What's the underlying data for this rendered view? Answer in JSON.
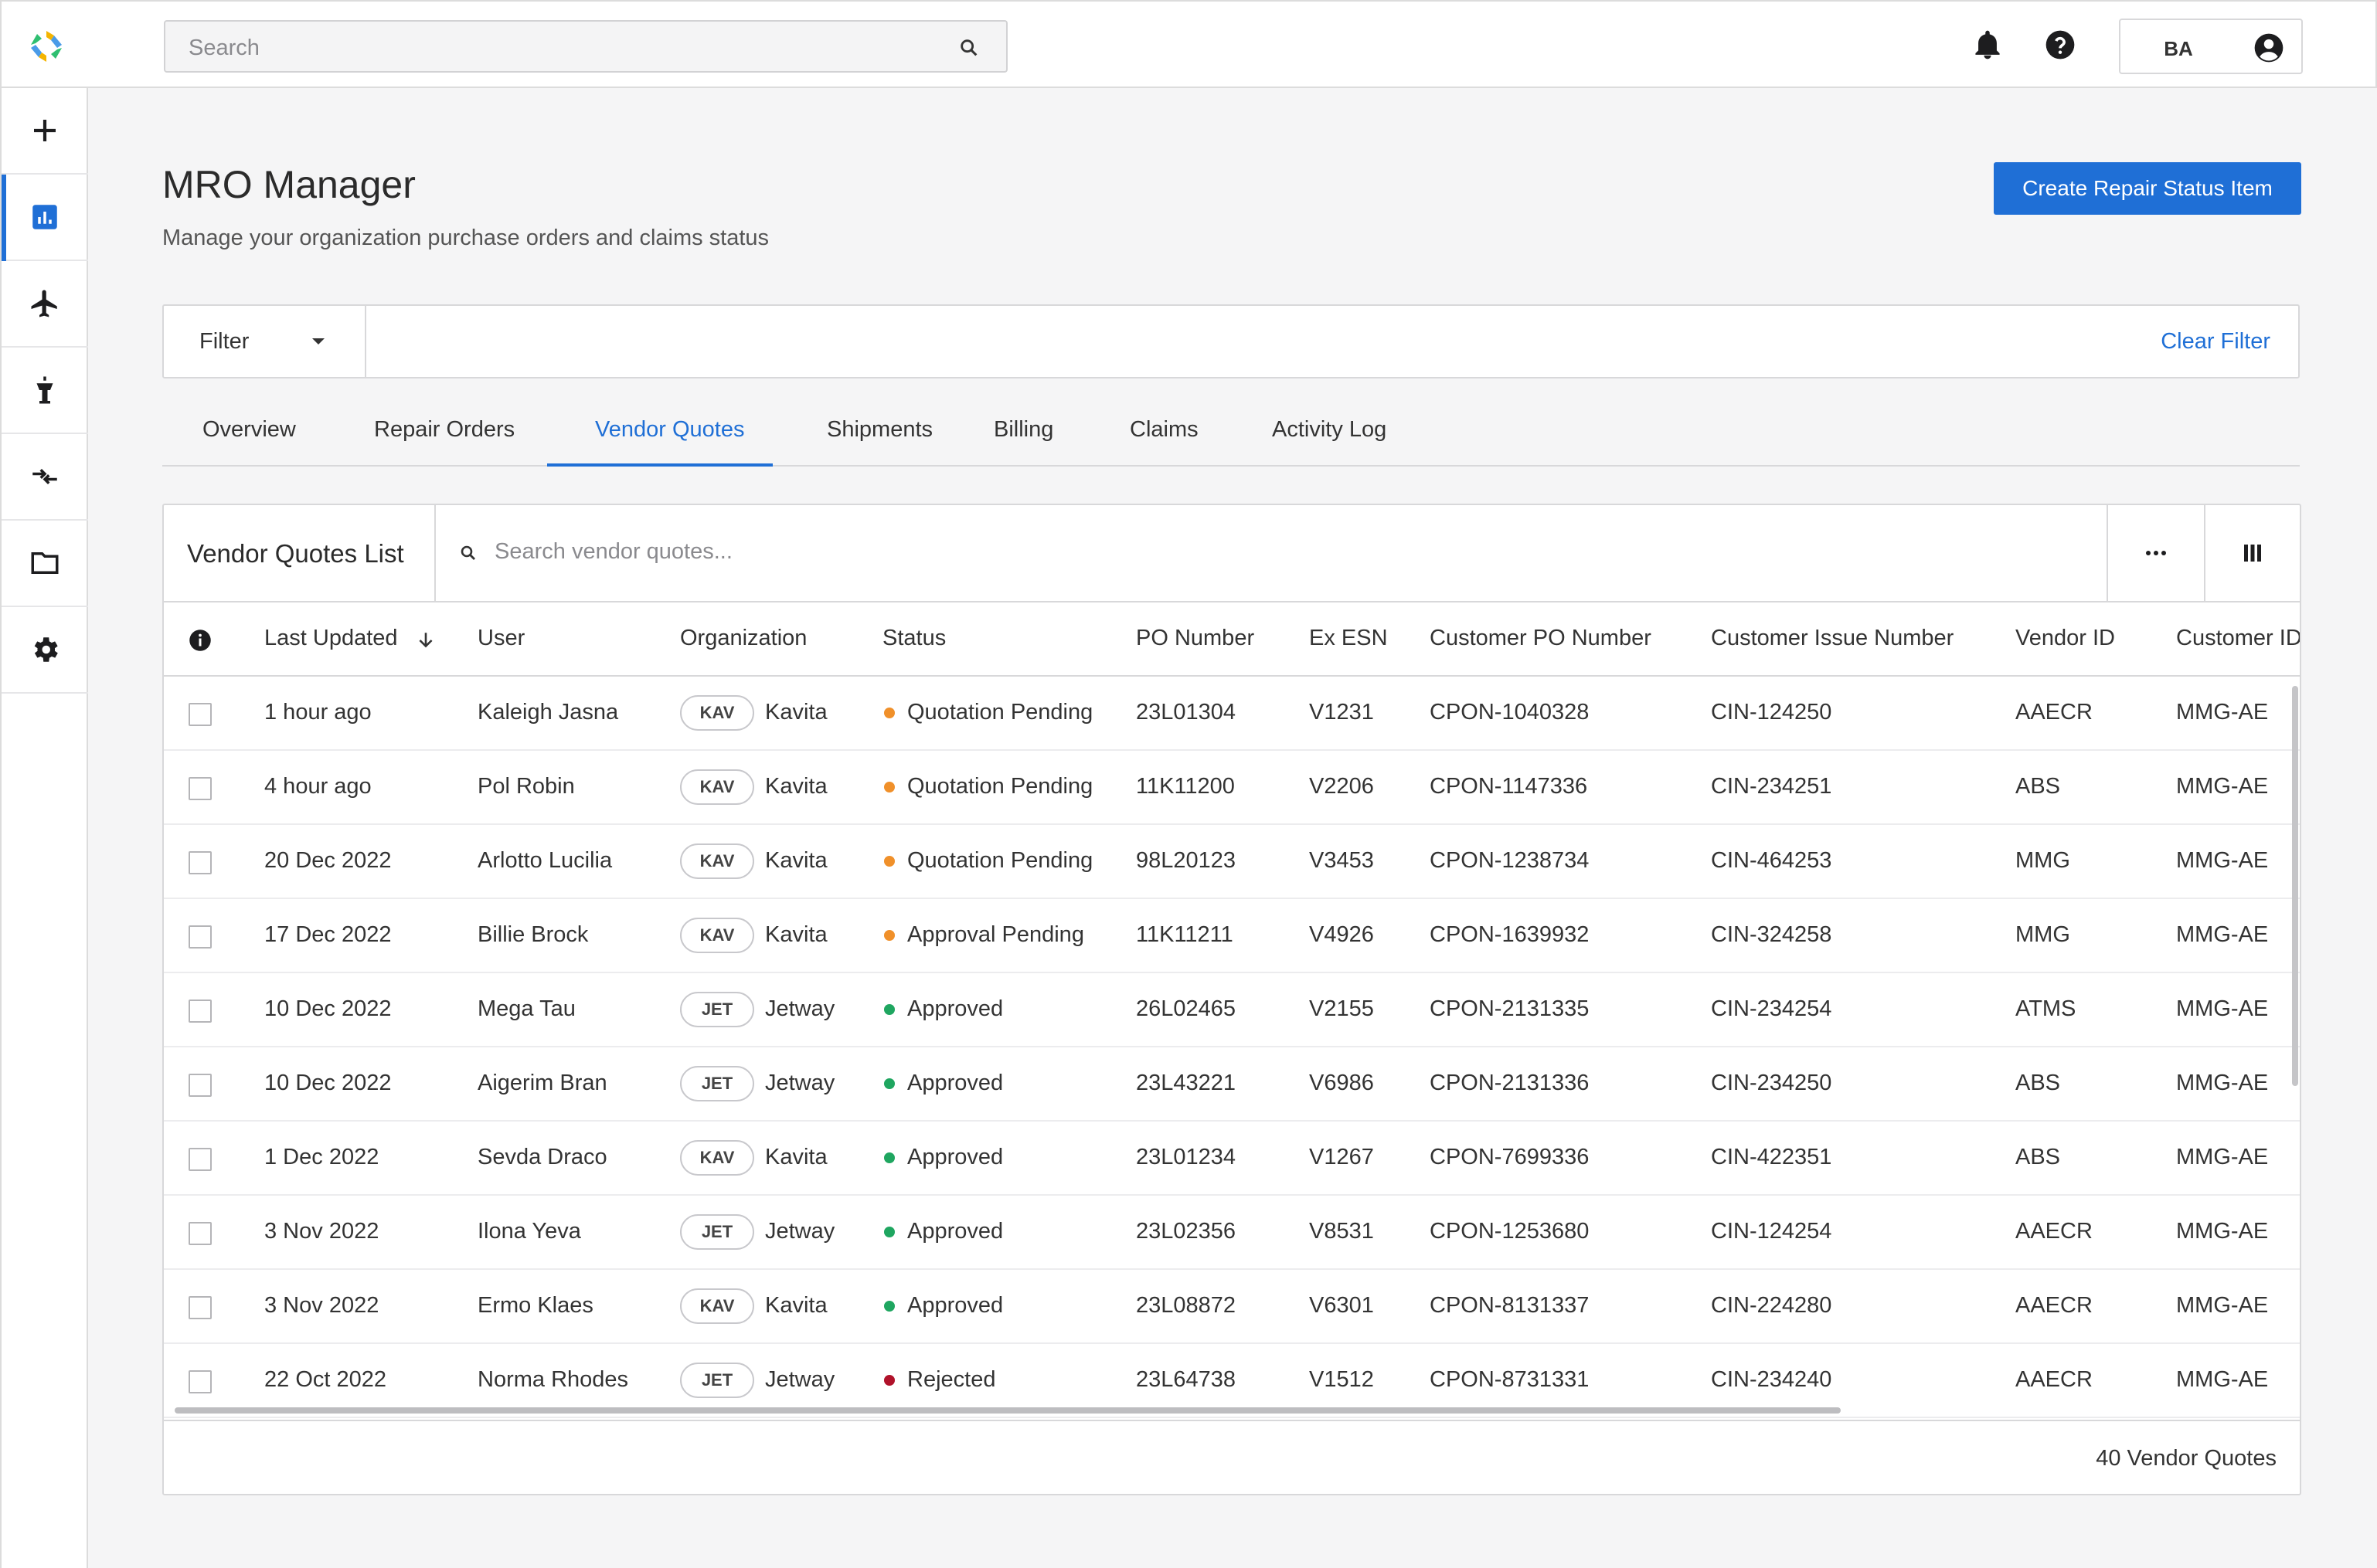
{
  "header": {
    "search_placeholder": "Search",
    "user_initials": "BA"
  },
  "sidebar": {
    "items": [
      {
        "icon": "plus-icon"
      },
      {
        "icon": "dashboard-icon",
        "active": true
      },
      {
        "icon": "airplane-icon"
      },
      {
        "icon": "control-tower-icon"
      },
      {
        "icon": "transfer-arrows-icon"
      },
      {
        "icon": "folder-icon"
      },
      {
        "icon": "gear-icon"
      }
    ]
  },
  "page": {
    "title": "MRO Manager",
    "subtitle": "Manage your organization purchase orders and claims status",
    "create_button": "Create Repair Status Item"
  },
  "filter": {
    "label": "Filter",
    "clear": "Clear Filter"
  },
  "tabs": [
    "Overview",
    "Repair Orders",
    "Vendor Quotes",
    "Shipments",
    "Billing",
    "Claims",
    "Activity Log"
  ],
  "active_tab": "Vendor Quotes",
  "panel": {
    "title": "Vendor Quotes List",
    "search_placeholder": "Search vendor quotes...",
    "count_label": "40 Vendor Quotes"
  },
  "table": {
    "columns": [
      "Last Updated",
      "User",
      "Organization",
      "Status",
      "PO Number",
      "Ex ESN",
      "Customer PO Number",
      "Customer Issue Number",
      "Vendor ID",
      "Customer ID"
    ],
    "status_colors": {
      "Quotation Pending": "#f0902a",
      "Approval Pending": "#f0902a",
      "Approved": "#1fa660",
      "Rejected": "#b0122a"
    },
    "rows": [
      {
        "updated": "1 hour ago",
        "user": "Kaleigh Jasna",
        "org_code": "KAV",
        "org": "Kavita",
        "status": "Quotation Pending",
        "po": "23L01304",
        "esn": "V1231",
        "cpo": "CPON-1040328",
        "cin": "CIN-124250",
        "vendor": "AAECR",
        "customer": "MMG-AE"
      },
      {
        "updated": "4 hour ago",
        "user": "Pol Robin",
        "org_code": "KAV",
        "org": "Kavita",
        "status": "Quotation Pending",
        "po": "11K11200",
        "esn": "V2206",
        "cpo": "CPON-1147336",
        "cin": "CIN-234251",
        "vendor": "ABS",
        "customer": "MMG-AE"
      },
      {
        "updated": "20 Dec 2022",
        "user": "Arlotto Lucilia",
        "org_code": "KAV",
        "org": "Kavita",
        "status": "Quotation Pending",
        "po": "98L20123",
        "esn": "V3453",
        "cpo": "CPON-1238734",
        "cin": "CIN-464253",
        "vendor": "MMG",
        "customer": "MMG-AE"
      },
      {
        "updated": "17 Dec 2022",
        "user": "Billie Brock",
        "org_code": "KAV",
        "org": "Kavita",
        "status": "Approval Pending",
        "po": "11K11211",
        "esn": "V4926",
        "cpo": "CPON-1639932",
        "cin": "CIN-324258",
        "vendor": "MMG",
        "customer": "MMG-AE"
      },
      {
        "updated": "10 Dec 2022",
        "user": "Mega Tau",
        "org_code": "JET",
        "org": "Jetway",
        "status": "Approved",
        "po": "26L02465",
        "esn": "V2155",
        "cpo": "CPON-2131335",
        "cin": "CIN-234254",
        "vendor": "ATMS",
        "customer": "MMG-AE"
      },
      {
        "updated": "10 Dec 2022",
        "user": "Aigerim Bran",
        "org_code": "JET",
        "org": "Jetway",
        "status": "Approved",
        "po": "23L43221",
        "esn": "V6986",
        "cpo": "CPON-2131336",
        "cin": "CIN-234250",
        "vendor": "ABS",
        "customer": "MMG-AE"
      },
      {
        "updated": "1 Dec 2022",
        "user": "Sevda Draco",
        "org_code": "KAV",
        "org": "Kavita",
        "status": "Approved",
        "po": "23L01234",
        "esn": "V1267",
        "cpo": "CPON-7699336",
        "cin": "CIN-422351",
        "vendor": "ABS",
        "customer": "MMG-AE"
      },
      {
        "updated": "3 Nov 2022",
        "user": "Ilona Yeva",
        "org_code": "JET",
        "org": "Jetway",
        "status": "Approved",
        "po": "23L02356",
        "esn": "V8531",
        "cpo": "CPON-1253680",
        "cin": "CIN-124254",
        "vendor": "AAECR",
        "customer": "MMG-AE"
      },
      {
        "updated": "3 Nov 2022",
        "user": "Ermo Klaes",
        "org_code": "KAV",
        "org": "Kavita",
        "status": "Approved",
        "po": "23L08872",
        "esn": "V6301",
        "cpo": "CPON-8131337",
        "cin": "CIN-224280",
        "vendor": "AAECR",
        "customer": "MMG-AE"
      },
      {
        "updated": "22 Oct 2022",
        "user": "Norma Rhodes",
        "org_code": "JET",
        "org": "Jetway",
        "status": "Rejected",
        "po": "23L64738",
        "esn": "V1512",
        "cpo": "CPON-8731331",
        "cin": "CIN-234240",
        "vendor": "AAECR",
        "customer": "MMG-AE"
      }
    ]
  }
}
